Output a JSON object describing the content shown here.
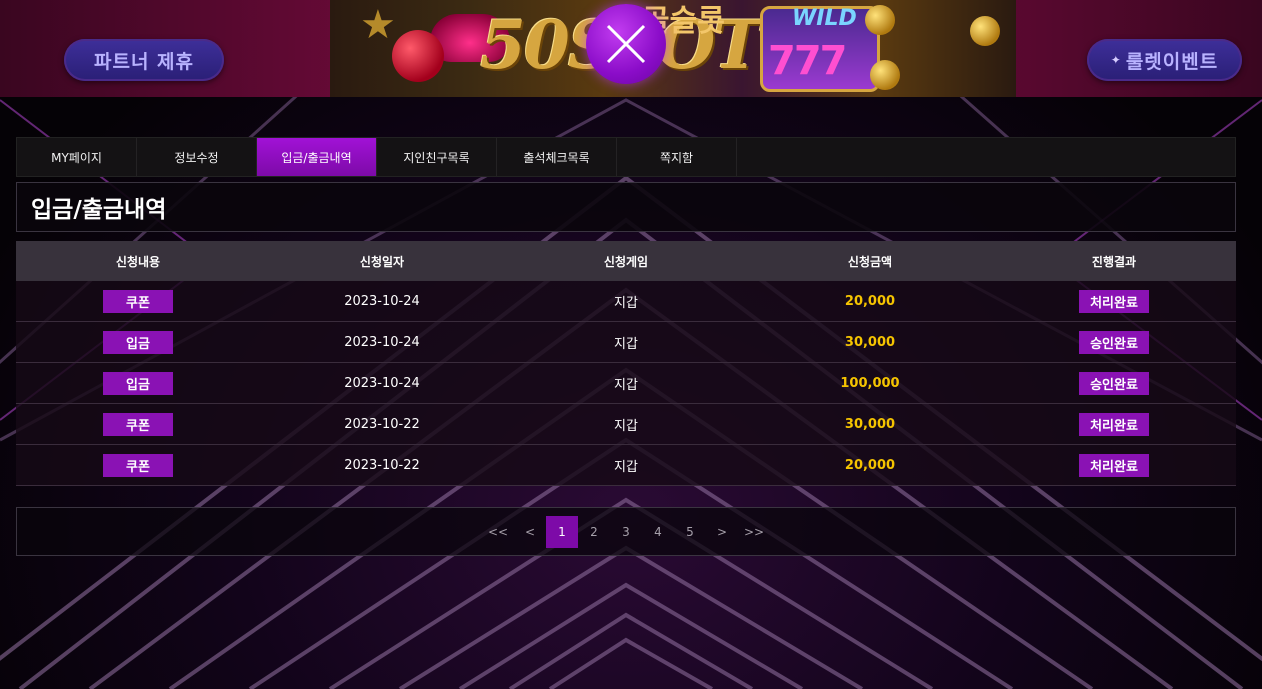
{
  "banner": {
    "left_button": "파트너 제휴",
    "right_button": "룰렛이벤트",
    "brand_text": "50SLOT",
    "brand_sub": "골슬롯",
    "wild_label": "WILD",
    "reels_text": "777"
  },
  "tabs": [
    {
      "label": "MY페이지"
    },
    {
      "label": "정보수정"
    },
    {
      "label": "입금/출금내역",
      "active": true
    },
    {
      "label": "지인친구목록"
    },
    {
      "label": "출석체크목록"
    },
    {
      "label": "쪽지함"
    }
  ],
  "page_title": "입금/출금내역",
  "table": {
    "headers": [
      "신청내용",
      "신청일자",
      "신청게임",
      "신청금액",
      "진행결과"
    ],
    "rows": [
      {
        "type": "쿠폰",
        "date": "2023-10-24",
        "game": "지갑",
        "amount": "20,000",
        "result": "처리완료"
      },
      {
        "type": "입금",
        "date": "2023-10-24",
        "game": "지갑",
        "amount": "30,000",
        "result": "승인완료"
      },
      {
        "type": "입금",
        "date": "2023-10-24",
        "game": "지갑",
        "amount": "100,000",
        "result": "승인완료"
      },
      {
        "type": "쿠폰",
        "date": "2023-10-22",
        "game": "지갑",
        "amount": "30,000",
        "result": "처리완료"
      },
      {
        "type": "쿠폰",
        "date": "2023-10-22",
        "game": "지갑",
        "amount": "20,000",
        "result": "처리완료"
      }
    ]
  },
  "pagination": {
    "first": "<<",
    "prev": "<",
    "pages": [
      "1",
      "2",
      "3",
      "4",
      "5"
    ],
    "current": "1",
    "next": ">",
    "last": ">>"
  },
  "colors": {
    "accent": "#8a12b4",
    "amount": "#f5c400",
    "header_bg": "#38323c"
  }
}
